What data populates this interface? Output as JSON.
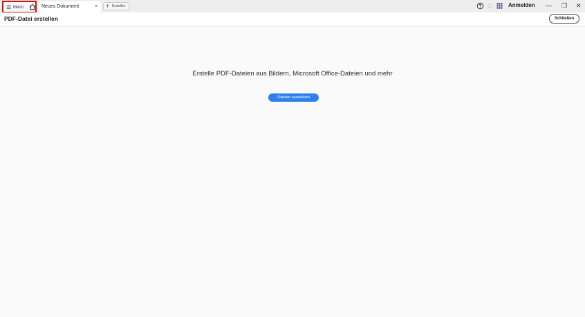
{
  "titlebar": {
    "menu_label": "Menü",
    "menu_icon": "hamburger-icon",
    "home_icon": "home-icon",
    "active_tab": {
      "title": "Neues Dokument",
      "close": "×"
    },
    "new_tab_label": "Erstellen",
    "new_tab_plus": "+",
    "right_icons": [
      "help-icon",
      "bell-icon",
      "apps-grid-icon"
    ],
    "sign_in": "Anmelden",
    "window_controls": {
      "minimize": "—",
      "restore": "❐",
      "close": "✕"
    }
  },
  "header": {
    "title": "PDF-Datei erstellen",
    "close_button": "Schließen"
  },
  "main": {
    "headline": "Erstelle PDF-Dateien aus Bildern, Microsoft Office-Dateien und mehr",
    "choose_files_button": "Dateien auswählen"
  },
  "colors": {
    "accent": "#2f80ed",
    "highlight_border": "#cc1414",
    "titlebar_bg": "#eeeeee",
    "content_bg": "#fafafa"
  }
}
